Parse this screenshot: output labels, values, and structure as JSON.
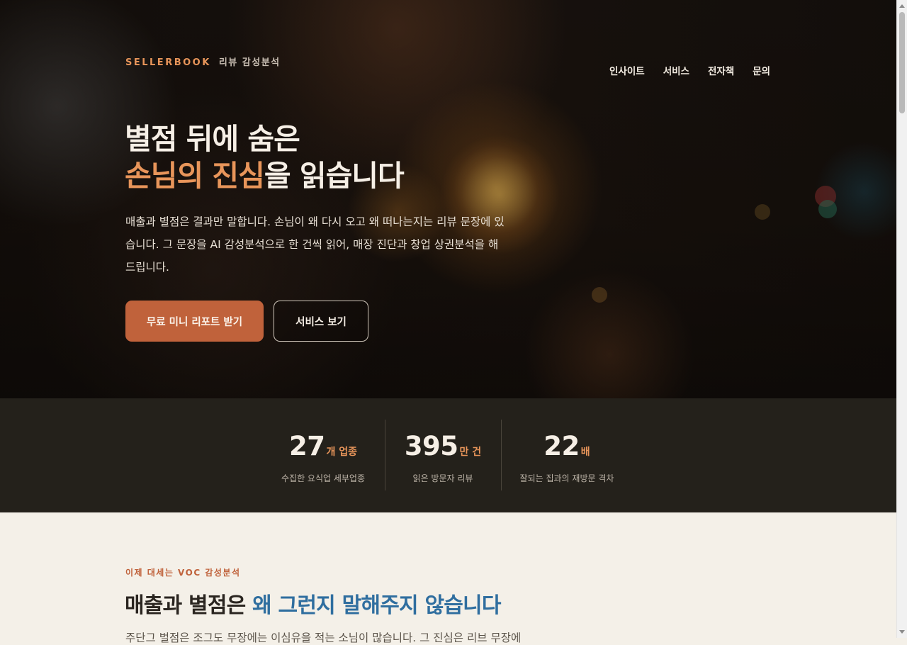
{
  "header": {
    "brand_main": "SELLERBOOK",
    "brand_sub": "리뷰 감성분석",
    "nav": [
      {
        "label": "인사이트"
      },
      {
        "label": "서비스"
      },
      {
        "label": "전자책"
      },
      {
        "label": "문의"
      }
    ]
  },
  "hero": {
    "title_line1": "별점 뒤에 숨은",
    "title_line2_accent": "손님의 진심",
    "title_line2_rest": "을 읽습니다",
    "description": "매출과 별점은 결과만 말합니다. 손님이 왜 다시 오고 왜 떠나는지는 리뷰 문장에 있습니다. 그 문장을 AI 감성분석으로 한 건씩 읽어, 매장 진단과 창업 상권분석을 해드립니다.",
    "primary_button": "무료 미니 리포트 받기",
    "secondary_button": "서비스 보기"
  },
  "stats": [
    {
      "value": "27",
      "unit": "개 업종",
      "label": "수집한 요식업 세부업종"
    },
    {
      "value": "395",
      "unit": "만 건",
      "label": "읽은 방문자 리뷰"
    },
    {
      "value": "22",
      "unit": "배",
      "label": "잘되는 집과의 재방문 격차"
    }
  ],
  "section": {
    "kicker": "이제 대세는 VOC 감성분석",
    "title_plain": "매출과 별점은",
    "title_accent": "왜 그런지 말해주지 않습니다",
    "body": "주단그 벌점은 조그도 무장에는 이심유을 적는 소님이 많습니다. 그 진심은 리브 무장에"
  },
  "colors": {
    "accent_orange": "#e8955a",
    "button_primary": "#c0623b",
    "stats_bg": "#24211b",
    "section_bg": "#f4f0e8",
    "accent_blue": "#2f6e9f"
  }
}
